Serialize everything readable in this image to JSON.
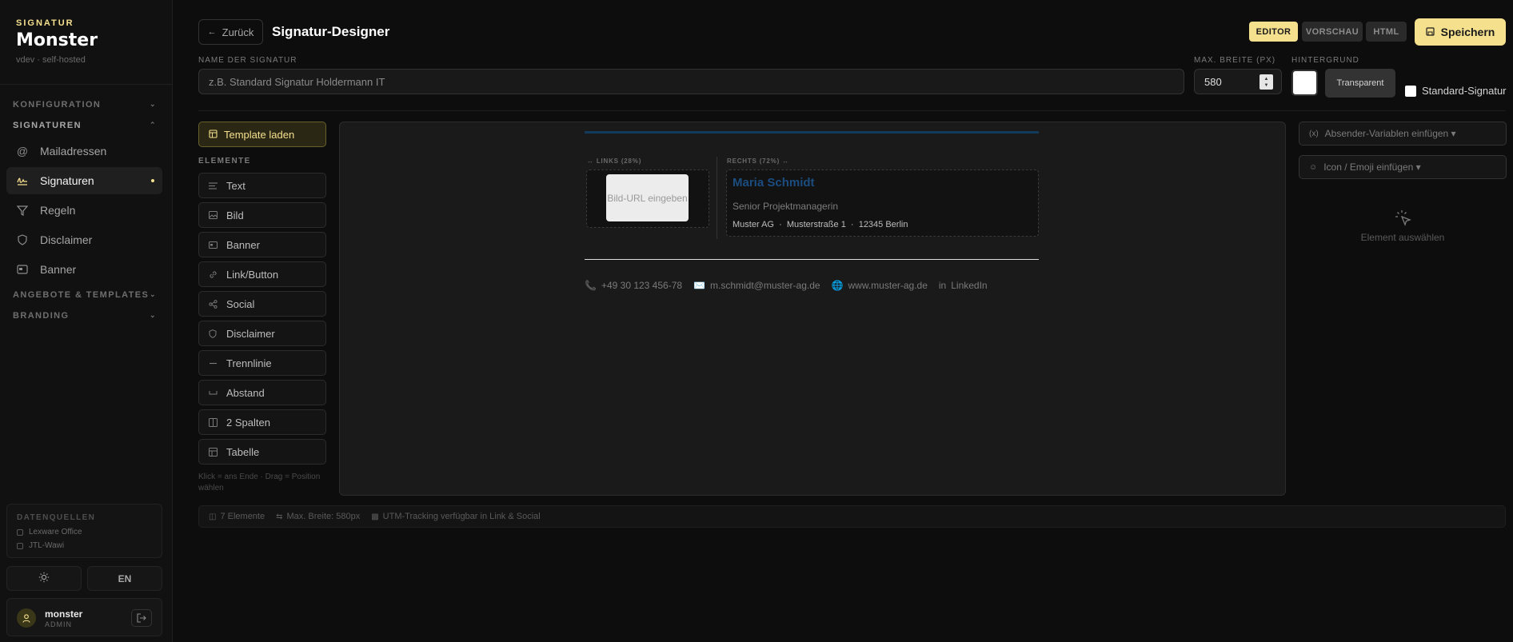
{
  "sidebar": {
    "brand_top": "SIGNATUR",
    "brand_name": "Monster",
    "version": "vdev · self-hosted",
    "sections": {
      "konfiguration": "KONFIGURATION",
      "signaturen": "SIGNATUREN",
      "angebote": "ANGEBOTE & TEMPLATES",
      "branding": "BRANDING"
    },
    "items": [
      {
        "label": "Mailadressen",
        "icon": "at-icon"
      },
      {
        "label": "Signaturen",
        "icon": "signature-icon",
        "active": true
      },
      {
        "label": "Regeln",
        "icon": "filter-icon"
      },
      {
        "label": "Disclaimer",
        "icon": "shield-icon"
      },
      {
        "label": "Banner",
        "icon": "banner-icon"
      }
    ],
    "datasources": {
      "title": "DATENQUELLEN",
      "items": [
        "Lexware Office",
        "JTL-Wawi"
      ]
    },
    "lang": "EN",
    "user": {
      "name": "monster",
      "role": "ADMIN"
    }
  },
  "header": {
    "back": "Zurück",
    "title": "Signatur-Designer",
    "tabs": [
      "EDITOR",
      "VORSCHAU",
      "HTML"
    ],
    "active_tab": "EDITOR",
    "save": "Speichern"
  },
  "form": {
    "name_label": "NAME DER SIGNATUR",
    "name_placeholder": "z.B. Standard Signatur Holdermann IT",
    "width_label": "MAX. BREITE (PX)",
    "width_value": "580",
    "bg_label": "HINTERGRUND",
    "bg_color": "#ffffff",
    "transparent": "Transparent",
    "default_sig": "Standard-Signatur"
  },
  "elements": {
    "template_btn": "Template laden",
    "title": "ELEMENTE",
    "items": [
      {
        "label": "Text",
        "icon": "text-icon"
      },
      {
        "label": "Bild",
        "icon": "image-icon"
      },
      {
        "label": "Banner",
        "icon": "banner-icon"
      },
      {
        "label": "Link/Button",
        "icon": "link-icon"
      },
      {
        "label": "Social",
        "icon": "share-icon"
      },
      {
        "label": "Disclaimer",
        "icon": "shield-icon"
      },
      {
        "label": "Trennlinie",
        "icon": "divider-icon"
      },
      {
        "label": "Abstand",
        "icon": "spacing-icon"
      },
      {
        "label": "2 Spalten",
        "icon": "columns-icon"
      },
      {
        "label": "Tabelle",
        "icon": "table-icon"
      }
    ],
    "hint": "Klick = ans Ende · Drag = Position wählen"
  },
  "canvas": {
    "col_left_label": "↔ LINKS (28%)",
    "col_right_label": "RECHTS (72%) ↔",
    "image_placeholder": "Bild-URL eingeben",
    "name": "Maria Schmidt",
    "role": "Senior Projektmanagerin",
    "address": "Muster AG  ·  Musterstraße 1  ·  12345 Berlin",
    "phone": "+49 30 123 456-78",
    "email": "m.schmidt@muster-ag.de",
    "web": "www.muster-ag.de",
    "linkedin": "LinkedIn",
    "accent_color": "#1b4d80"
  },
  "right": {
    "vars_btn": "Absender-Variablen einfügen ▾",
    "emoji_btn": "Icon / Emoji einfügen ▾",
    "select_hint": "Element auswählen"
  },
  "status": {
    "elements": "7 Elemente",
    "width": "Max. Breite: 580px",
    "utm": "UTM-Tracking verfügbar in Link & Social"
  }
}
